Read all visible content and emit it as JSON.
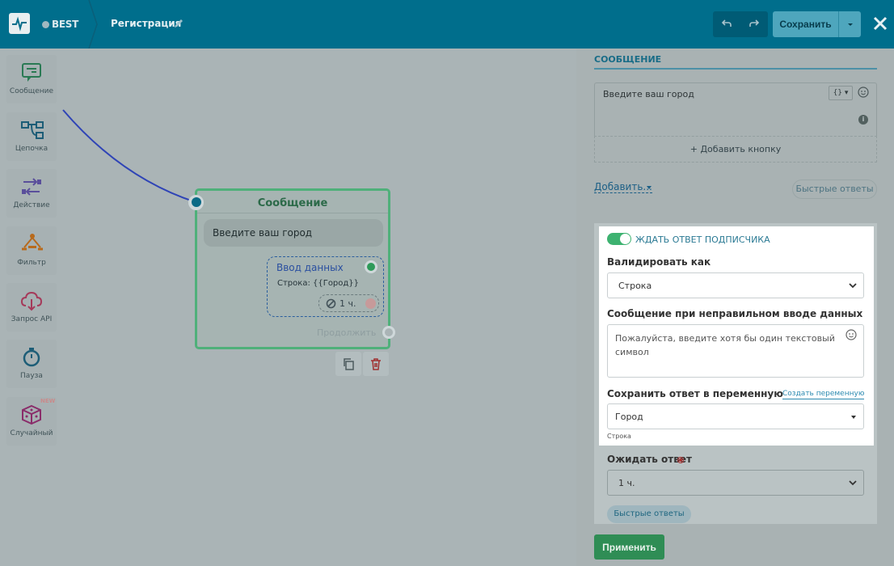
{
  "header": {
    "brand": "BEST",
    "page_title": "Регистрация",
    "save_label": "Сохранить"
  },
  "palette": [
    {
      "label": "Сообщение",
      "icon": "message-icon"
    },
    {
      "label": "Цепочка",
      "icon": "chain-icon"
    },
    {
      "label": "Действие",
      "icon": "action-icon"
    },
    {
      "label": "Фильтр",
      "icon": "filter-icon"
    },
    {
      "label": "Запрос API",
      "icon": "api-cloud-icon"
    },
    {
      "label": "Пауза",
      "icon": "stopwatch-icon"
    },
    {
      "label": "Случайный",
      "icon": "dice-icon",
      "badge": "NEW"
    }
  ],
  "node": {
    "title": "Сообщение",
    "message": "Введите ваш город",
    "input_title": "Ввод данных",
    "input_var": "Строка: {{Город}}",
    "timeout": "1 ч.",
    "continue": "Продолжить"
  },
  "panel": {
    "section_title": "СООБЩЕНИЕ",
    "message_text": "Введите ваш город",
    "add_button": "+ Добавить кнопку",
    "add_link": "Добавить...",
    "quick_replies": "Быстрые ответы",
    "wait_toggle": "ЖДАТЬ ОТВЕТ ПОДПИСЧИКА",
    "validate_label": "Валидировать как",
    "validate_value": "Строка",
    "error_label": "Сообщение при неправильном вводе данных",
    "error_text": "Пожалуйста, введите хотя бы один текстовый символ",
    "save_var_label": "Сохранить ответ в переменную",
    "create_var": "Создать переменную",
    "var_value": "Город",
    "var_hint": "Строка",
    "wait_label": "Ожидать ответ",
    "wait_value": "1 ч.",
    "quick_replies_bottom": "Быстрые ответы",
    "apply": "Применить"
  },
  "colors": {
    "topbar": "#006e8c",
    "accent_green": "#3db270",
    "node_border": "#4fb07a",
    "link_blue": "#2a4fa0"
  }
}
